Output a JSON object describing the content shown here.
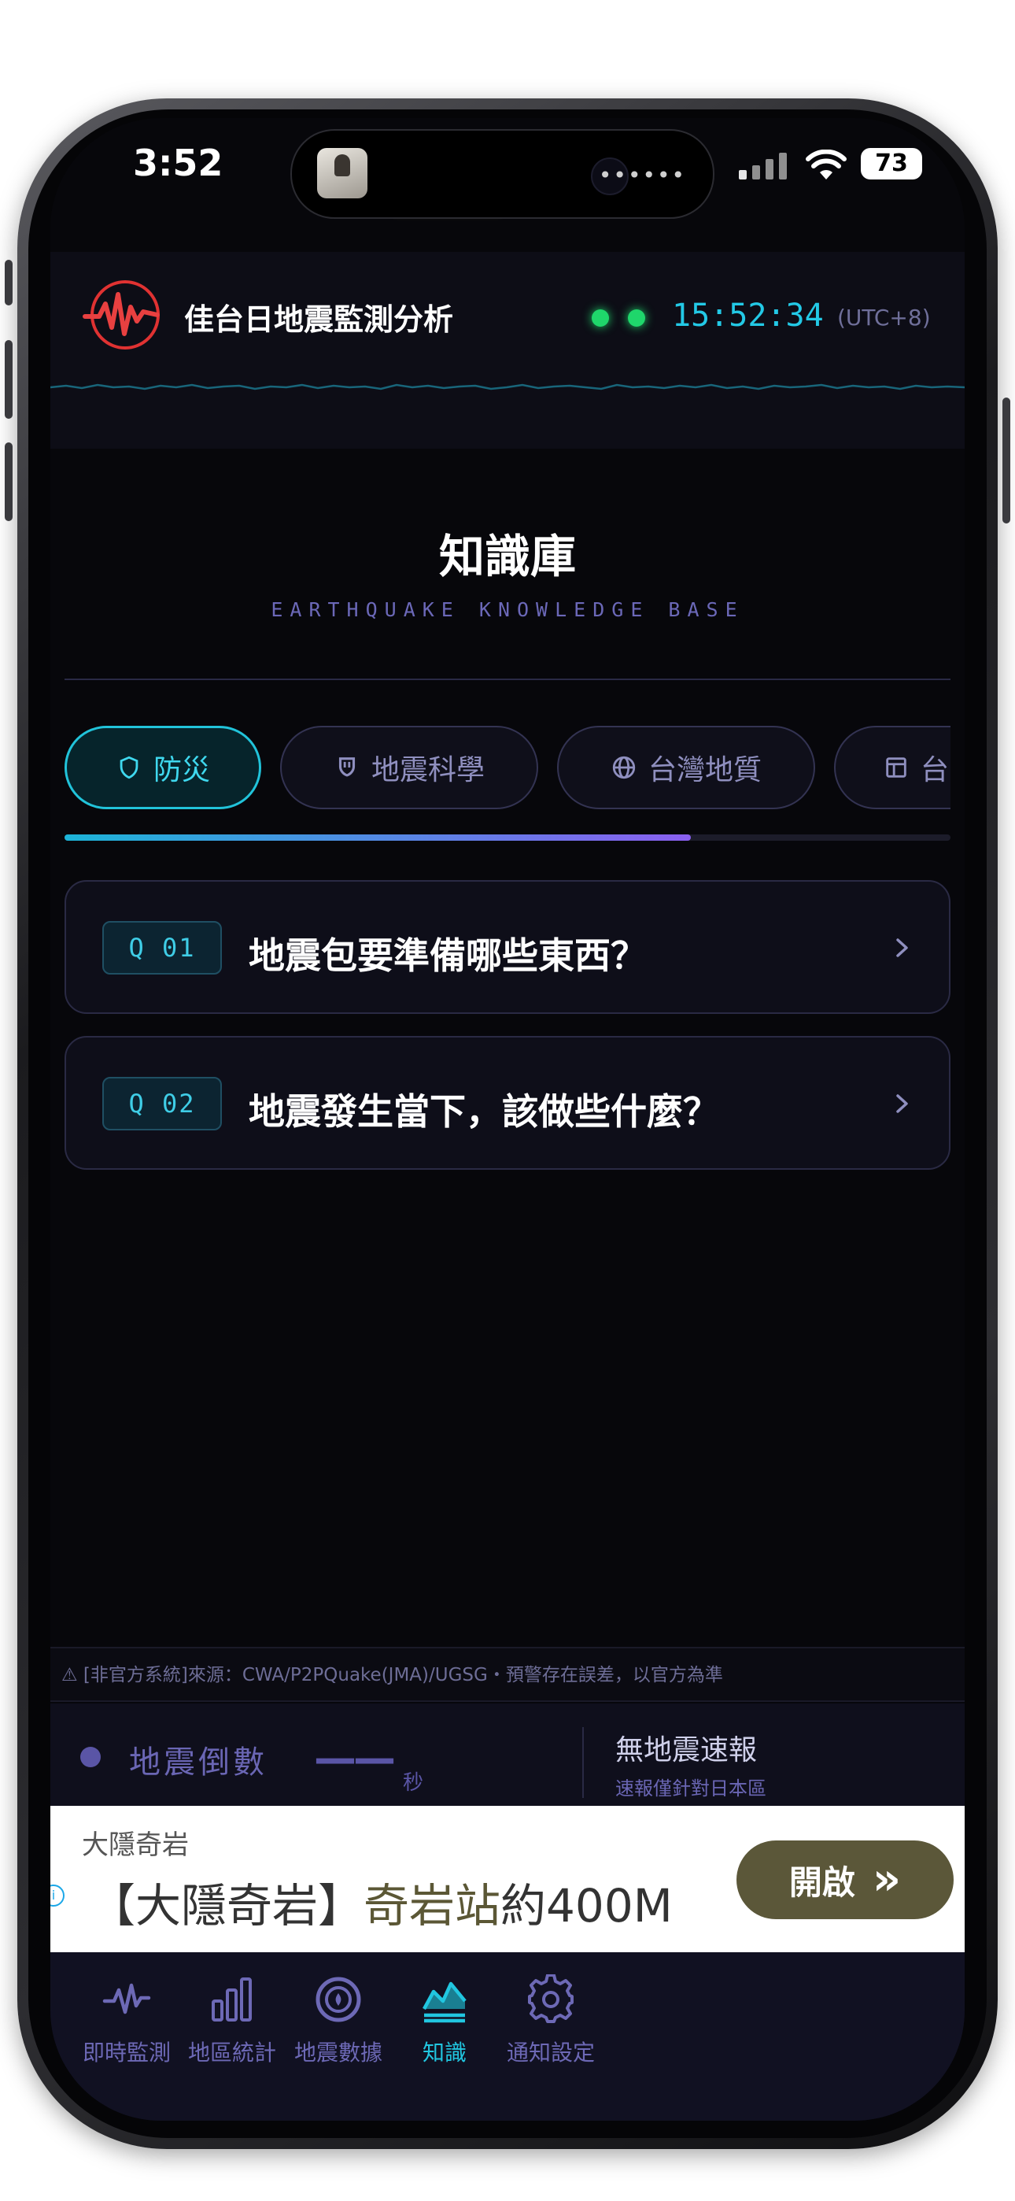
{
  "status_bar": {
    "time": "3:52",
    "battery": "73"
  },
  "header": {
    "app_title": "佳台日地震監測分析",
    "clock": "15:52:34",
    "timezone": "(UTC+8)"
  },
  "page": {
    "title": "知識庫",
    "subtitle": "EARTHQUAKE KNOWLEDGE BASE"
  },
  "tabs": [
    {
      "label": "防災",
      "icon": "shield-icon"
    },
    {
      "label": "地震科學",
      "icon": "shield-badge-icon"
    },
    {
      "label": "台灣地質",
      "icon": "globe-icon"
    },
    {
      "label": "台",
      "icon": "layout-icon"
    }
  ],
  "faqs": [
    {
      "badge": "Q 01",
      "question": "地震包要準備哪些東西？"
    },
    {
      "badge": "Q 02",
      "question": "地震發生當下，該做些什麼？"
    }
  ],
  "disclaimer": "⚠ [非官方系統]來源：CWA/P2PQuake(JMA)/UGSG・預警存在誤差，以官方為準",
  "quake_bar": {
    "label": "地震倒數",
    "countdown": "——",
    "unit": "秒",
    "status": "無地震速報",
    "note": "速報僅針對日本區"
  },
  "ad": {
    "brand": "大隱奇岩",
    "headline_prefix": "【大隱奇岩】",
    "headline_highlight": "奇岩站",
    "headline_suffix": "約400M",
    "button": "開啟",
    "button_icon": "»"
  },
  "nav": [
    {
      "label": "即時監測",
      "icon": "pulse-icon"
    },
    {
      "label": "地區統計",
      "icon": "bar-chart-icon"
    },
    {
      "label": "地震數據",
      "icon": "target-icon"
    },
    {
      "label": "知識",
      "icon": "chart-area-icon",
      "active": true
    },
    {
      "label": "通知設定",
      "icon": "gear-icon"
    }
  ],
  "colors": {
    "accent": "#21c6e0",
    "purple": "#6d69b6",
    "green": "#1fd66b",
    "background": "#07070b"
  }
}
